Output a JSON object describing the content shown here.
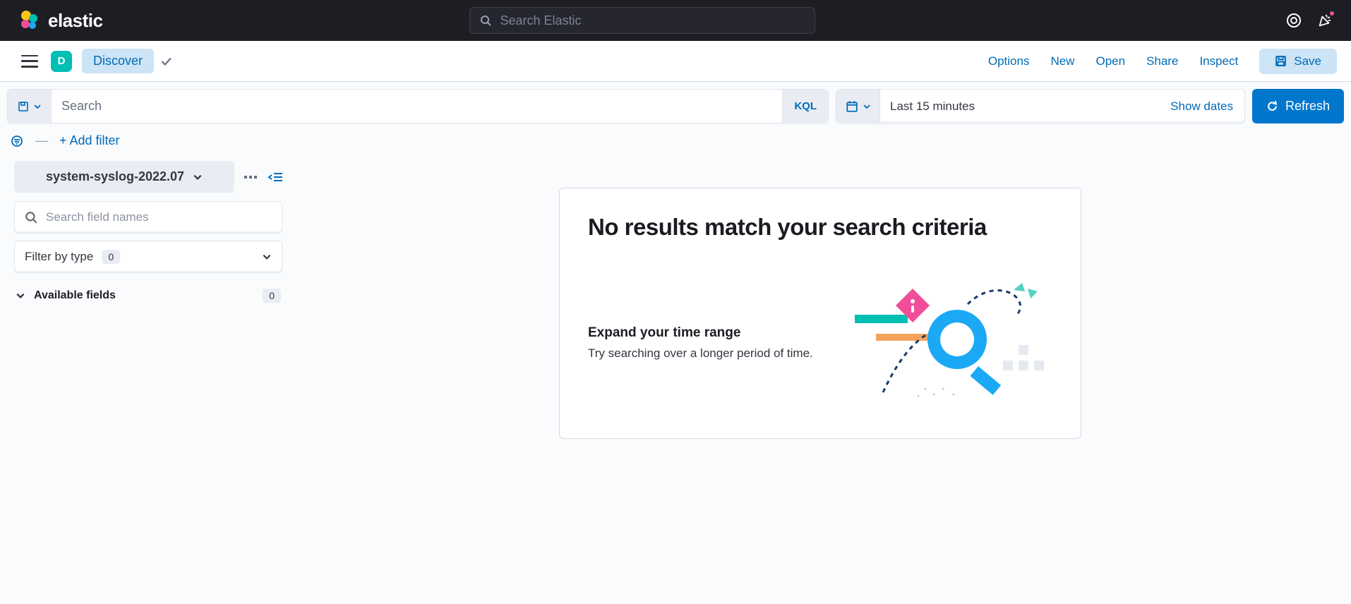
{
  "header": {
    "brand": "elastic",
    "search_placeholder": "Search Elastic"
  },
  "subheader": {
    "space_letter": "D",
    "app_name": "Discover",
    "actions": {
      "options": "Options",
      "new": "New",
      "open": "Open",
      "share": "Share",
      "inspect": "Inspect",
      "save": "Save"
    }
  },
  "query": {
    "placeholder": "Search",
    "lang": "KQL",
    "time_label": "Last 15 minutes",
    "show_dates": "Show dates",
    "refresh": "Refresh"
  },
  "filters": {
    "add_filter": "+ Add filter"
  },
  "sidebar": {
    "index_pattern": "system-syslog-2022.07",
    "field_search_placeholder": "Search field names",
    "filter_by_type_label": "Filter by type",
    "filter_by_type_count": "0",
    "available_fields_label": "Available fields",
    "available_fields_count": "0"
  },
  "empty": {
    "title": "No results match your search criteria",
    "expand_title": "Expand your time range",
    "expand_desc": "Try searching over a longer period of time."
  }
}
